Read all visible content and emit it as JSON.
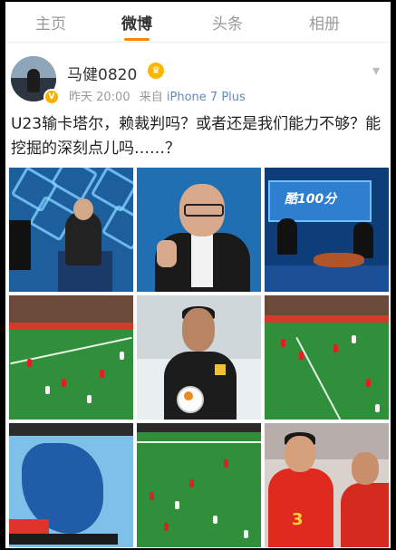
{
  "tabs": [
    "主页",
    "微博",
    "头条",
    "相册"
  ],
  "active_tab_index": 1,
  "user": {
    "name": "马健0820",
    "verified_badge": "V",
    "level_badge": "♛"
  },
  "post": {
    "time": "昨天 20:00",
    "from_label": "来自",
    "device": "iPhone 7 Plus",
    "text": "U23输卡塔尔，赖裁判吗？或者还是我们能力不够？能挖掘的深刻点儿吗……？"
  },
  "images": {
    "c3_screen_text": "酷100分",
    "c9_number": "3"
  },
  "colors": {
    "accent": "#ff8200",
    "link": "#5b8cc4"
  }
}
